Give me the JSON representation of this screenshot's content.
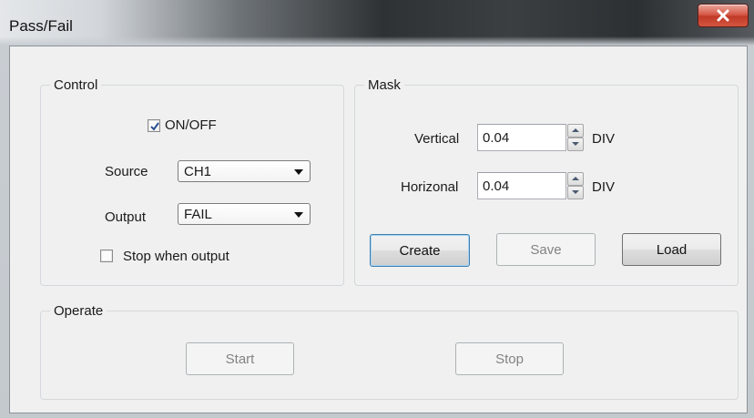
{
  "window": {
    "title": "Pass/Fail",
    "close_glyph": "x"
  },
  "control": {
    "group_title": "Control",
    "on_off": {
      "label": "ON/OFF",
      "checked": true
    },
    "source": {
      "label": "Source",
      "value": "CH1"
    },
    "output": {
      "label": "Output",
      "value": "FAIL"
    },
    "stop_when_output": {
      "label": "Stop when output",
      "checked": false
    }
  },
  "mask": {
    "group_title": "Mask",
    "vertical": {
      "label": "Vertical",
      "value": "0.04",
      "unit": "DIV"
    },
    "horizontal": {
      "label": "Horizonal",
      "value": "0.04",
      "unit": "DIV"
    },
    "buttons": {
      "create": "Create",
      "save": "Save",
      "load": "Load"
    }
  },
  "operate": {
    "group_title": "Operate",
    "buttons": {
      "start": "Start",
      "stop": "Stop"
    }
  },
  "colors": {
    "checkmark": "#2a4f8f",
    "close_button": "#c13a28",
    "default_button_border": "#3c7fb1",
    "disabled_text": "#838383"
  }
}
